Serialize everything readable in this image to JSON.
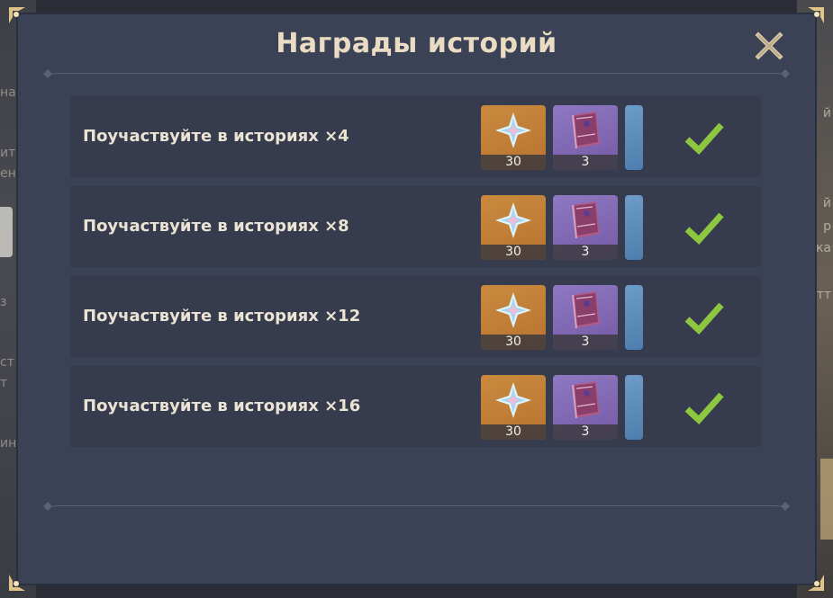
{
  "dialog": {
    "title": "Награды историй"
  },
  "rows": [
    {
      "label": "Поучаствуйте в историях ×4",
      "rewards": [
        {
          "item": "primogem-icon",
          "count": "30"
        },
        {
          "item": "hero-wit-book-icon",
          "count": "3"
        }
      ],
      "claimed": true
    },
    {
      "label": "Поучаствуйте в историях ×8",
      "rewards": [
        {
          "item": "primogem-icon",
          "count": "30"
        },
        {
          "item": "hero-wit-book-icon",
          "count": "3"
        }
      ],
      "claimed": true
    },
    {
      "label": "Поучаствуйте в историях ×12",
      "rewards": [
        {
          "item": "primogem-icon",
          "count": "30"
        },
        {
          "item": "hero-wit-book-icon",
          "count": "3"
        }
      ],
      "claimed": true
    },
    {
      "label": "Поучаствуйте в историях ×16",
      "rewards": [
        {
          "item": "primogem-icon",
          "count": "30"
        },
        {
          "item": "hero-wit-book-icon",
          "count": "3"
        }
      ],
      "claimed": true
    }
  ],
  "colors": {
    "panel": "#3b4256",
    "row": "#363c4e",
    "title": "#e9dcc2",
    "check": "#8dc63f",
    "reward_gold": "#c98a3e",
    "reward_purple": "#8f78c2"
  }
}
